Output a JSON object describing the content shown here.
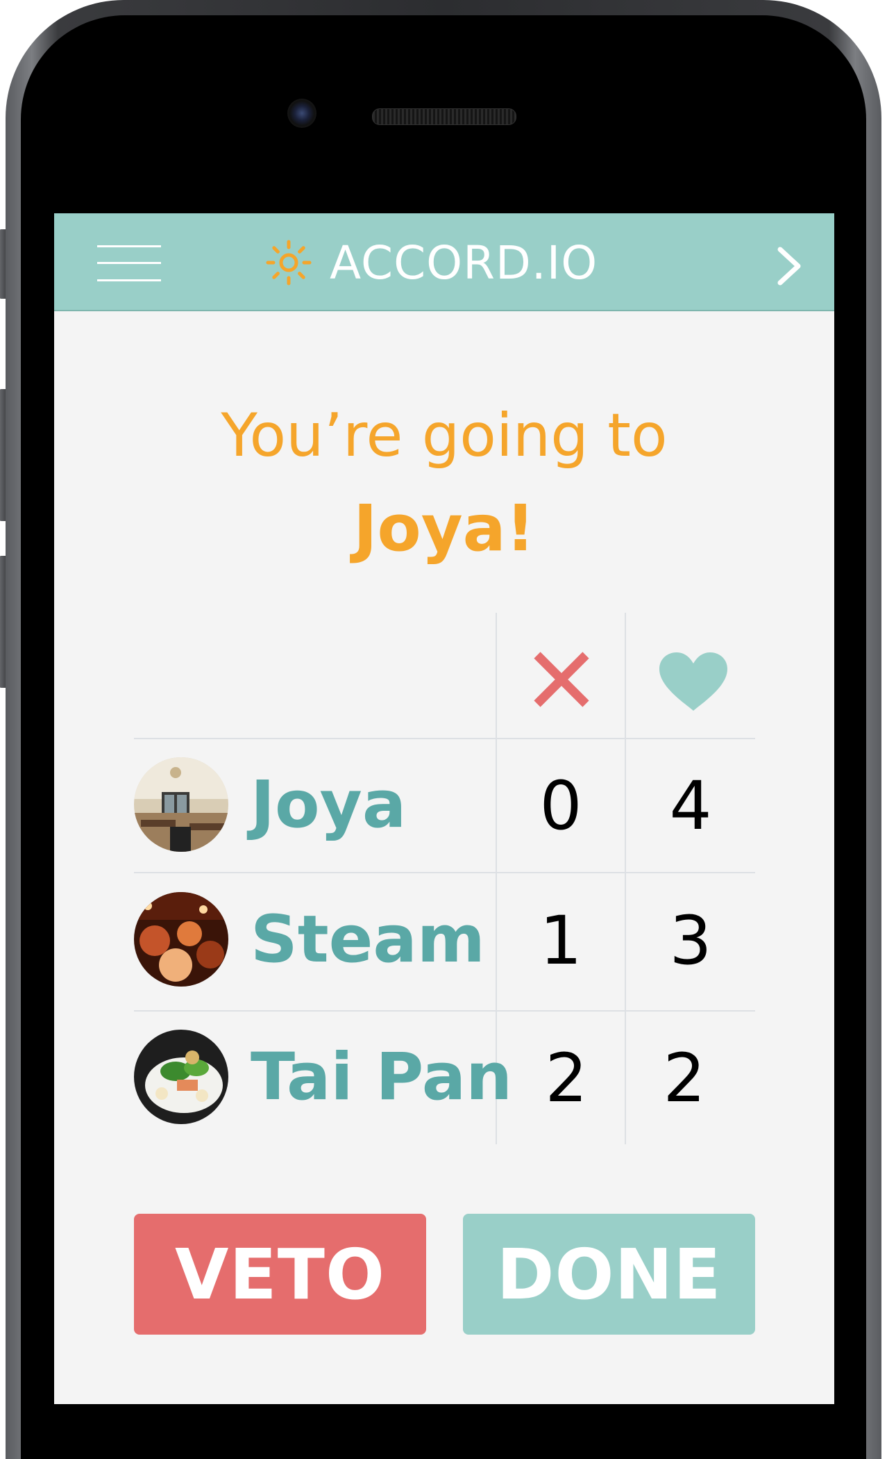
{
  "header": {
    "brand": "ACCORD.IO",
    "colors": {
      "bar": "#99cfc8",
      "sun": "#f5a52b"
    }
  },
  "result": {
    "line1": "You’re going to",
    "line2": "Joya!"
  },
  "table": {
    "columns": [
      {
        "icon": "x-icon",
        "color": "#e56d6d"
      },
      {
        "icon": "heart-icon",
        "color": "#99cfc8"
      }
    ],
    "rows": [
      {
        "name": "Joya",
        "vetoes": "0",
        "likes": "4"
      },
      {
        "name": "Steam",
        "vetoes": "1",
        "likes": "3"
      },
      {
        "name": "Tai Pan",
        "vetoes": "2",
        "likes": "2"
      }
    ]
  },
  "actions": {
    "veto_label": "VETO",
    "done_label": "DONE",
    "colors": {
      "veto": "#e56d6d",
      "done": "#99cfc8"
    }
  }
}
